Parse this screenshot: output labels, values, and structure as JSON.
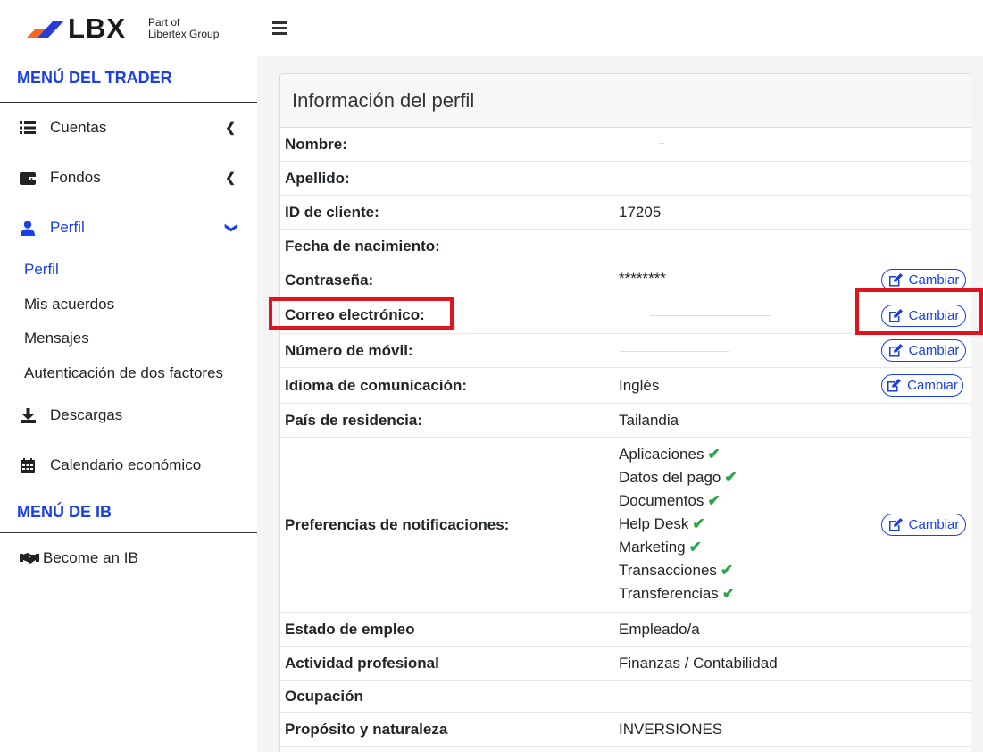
{
  "logo": {
    "brand": "LBX",
    "tagline_1": "Part of",
    "tagline_2": "Libertex Group"
  },
  "sidebar": {
    "trader_title": "MENÚ DEL TRADER",
    "items": [
      {
        "label": "Cuentas",
        "icon": "list-icon"
      },
      {
        "label": "Fondos",
        "icon": "wallet-icon"
      },
      {
        "label": "Perfil",
        "icon": "user-icon"
      }
    ],
    "profile_sub": [
      "Perfil",
      "Mis acuerdos",
      "Mensajes",
      "Autenticación de dos factores"
    ],
    "downloads": "Descargas",
    "calendar": "Calendario económico",
    "ib_title": "MENÚ DE IB",
    "ib_item": "Become an IB"
  },
  "card": {
    "title": "Información del perfil",
    "cambiar_label": "Cambiar",
    "rows": {
      "nombre": {
        "label": "Nombre:",
        "value": ""
      },
      "apellido": {
        "label": "Apellido:",
        "value": ""
      },
      "id": {
        "label": "ID de cliente:",
        "value": "17205"
      },
      "nacimiento": {
        "label": "Fecha de nacimiento:",
        "value": ""
      },
      "password": {
        "label": "Contraseña:",
        "value": "********"
      },
      "email": {
        "label": "Correo electrónico:",
        "value": ""
      },
      "movil": {
        "label": "Número de móvil:",
        "value": ""
      },
      "idioma": {
        "label": "Idioma de comunicación:",
        "value": "Inglés"
      },
      "pais": {
        "label": "País de residencia:",
        "value": "Tailandia"
      },
      "notif": {
        "label": "Preferencias de notificaciones:",
        "items": [
          "Aplicaciones",
          "Datos del pago",
          "Documentos",
          "Help Desk",
          "Marketing",
          "Transacciones",
          "Transferencias"
        ]
      },
      "empleo": {
        "label": "Estado de empleo",
        "value": "Empleado/a"
      },
      "actividad": {
        "label": "Actividad profesional",
        "value": "Finanzas / Contabilidad"
      },
      "ocupacion": {
        "label": "Ocupación",
        "value": ""
      },
      "proposito": {
        "label": "Propósito y naturaleza",
        "value": "INVERSIONES"
      }
    }
  },
  "colors": {
    "accent": "#1a3ee8",
    "check": "#28a745",
    "highlight": "#e0141e",
    "logo_orange": "#f26522",
    "logo_blue": "#2b3bd6"
  }
}
